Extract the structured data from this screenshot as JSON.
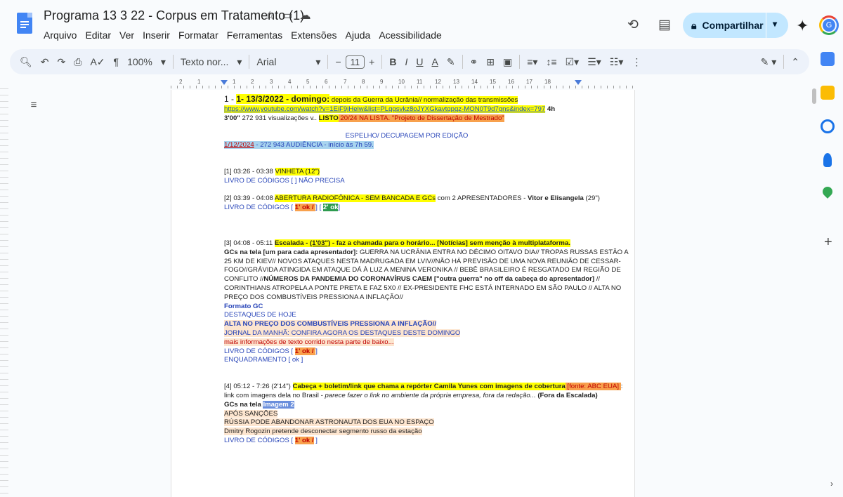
{
  "header": {
    "title": "Programa 13 3 22 - Corpus em Tratamento (1)",
    "menu": [
      "Arquivo",
      "Editar",
      "Ver",
      "Inserir",
      "Formatar",
      "Ferramentas",
      "Extensões",
      "Ajuda",
      "Acessibilidade"
    ],
    "share_label": "Compartilhar",
    "avatar_letter": "G"
  },
  "toolbar": {
    "zoom": "100%",
    "style": "Texto nor...",
    "font": "Arial",
    "font_size": "11"
  },
  "ruler": {
    "numbers": [
      "2",
      "1",
      "1",
      "1",
      "2",
      "3",
      "4",
      "5",
      "6",
      "7",
      "8",
      "9",
      "10",
      "11",
      "12",
      "13",
      "14",
      "15",
      "16",
      "17",
      "18"
    ]
  },
  "doc": {
    "l1_num": "1 -",
    "l1_hl": "1- 13/3/2022 - domingo:",
    "l1_rest": " depois da Guerra da Ucrânia// normalização das transmissões",
    "l2_link": "https://www.youtube.com/watch?v=1EiF9jHelw&list=PLqqsvkz8oJYXGkavtqpqz-MON0T9d7gns&index=797",
    "l2_dur": " 4h",
    "l3_a": "3'00\"",
    "l3_b": " 272 931 visualizações v.. ",
    "l3_listo": "LISTO",
    "l3_c": "  20/24 NA LISTA. \"Projeto de Dissertação de Mestrado\"",
    "espelho": "ESPELHO/ DECUPAGEM POR EDIÇÃO",
    "aud_date": "1/12/2024",
    "aud_rest": " - 272 943 AUDIÊNCIA  - início às 7h 59.",
    "s1_time": "[1] 03:26 - 03:38  ",
    "s1_hl": "VINHETA (12\")",
    "s1_livro": "LIVRO DE CÓDIGOS [  ] NÃO PRECISA",
    "s2_time": "[2] 03:39 - 04:08 ",
    "s2_hl": "ABERTURA RADIOFÔNICA - SEM BANCADA  E GCs",
    "s2_rest": " com 2 APRESENTADORES - ",
    "s2_names": "Vitor e Elisangela",
    "s2_dur": "  (29\")",
    "s2_livro": "LIVRO DE CÓDIGOS [ ",
    "s2_ok1": "1' ok  / ",
    "s2_mid": " ] [ ",
    "s2_ok2": "2' ok",
    "s2_end": "]",
    "s3_time": "[3] 04:08 - 05:11  ",
    "s3_hl_a": "Escalada - ",
    "s3_hl_b": "(1'03\")",
    "s3_hl_c": " - faz a chamada para o horário... [Notícias] sem menção à multiplataforma.",
    "s3_gcs_label": "GCs na tela [um para cada apresentador]:",
    "s3_gcs_text": "  GUERRA NA UCRÂNIA ENTRA NO DÉCIMO OITAVO DIA// TROPAS RUSSAS ESTÃO A 25 KM DE KIEV// NOVOS ATAQUES NESTA MADRUGADA EM LVIV//NÃO HÁ PREVISÃO DE UMA NOVA REUNIÃO DE CESSAR-FOGO//GRÁVIDA ATINGIDA EM ATAQUE DÁ À LUZ A MENINA VERONIKA // BEBÊ BRASILEIRO É RESGATADO EM REGIÃO DE CONFLITO //",
    "s3_gcs_bold": "NÚMEROS DA PANDEMIA DO CORONAVÍRUS CAEM [\"outra guerra\" no off da cabeça do apresentador]",
    "s3_gcs_text2": " // CORINTHIANS ATROPELA A PONTE PRETA E FAZ 5X0 // EX-PRESIDENTE FHC ESTÁ INTERNADO EM SÃO PAULO // ALTA NO PREÇO DOS COMBUSTÍVEIS PRESSIONA A INFLAÇÃO//",
    "s3_formato": "Formato GC",
    "s3_destaques": "DESTAQUES DE HOJE",
    "s3_alta": "ALTA NO PREÇO DOS COMBUSTÍVEIS PRESSIONA A INFLAÇÃO//",
    "s3_jornal": "JORNAL DA MANHÃ: CONFIRA AGORA OS DESTAQUES DESTE DOMINGO",
    "s3_mais": "mais informações de texto corrido nesta parte de baixo...",
    "s3_livro": "LIVRO DE CÓDIGOS [ ",
    "s3_ok": "1' ok  / ",
    "s3_livro_end": " ]",
    "s3_enq": "ENQUADRAMENTO [ ok  ]",
    "s4_time": "[4] 05:12 - 7:26  (2'14\")  ",
    "s4_hl": "Cabeça  + boletim/link que chama a repórter Camila Yunes com imagens de cobertura",
    "s4_fonte": " [fonte: ABC EUA] ",
    "s4_rest": ": link com imagens dela no Brasil - ",
    "s4_em": "parece fazer o link no ambiente da própria empresa, fora da redação...",
    "s4_fora": " (Fora da Escalada)",
    "s4_gcs": "GCs na tela ",
    "s4_img": "  Imagem 2 ",
    "s4_apos": "APÓS SANÇÕES",
    "s4_russia": "RÚSSIA PODE ABANDONAR ASTRONAUTA DOS EUA NO ESPAÇO",
    "s4_dmitry": "Dmitry Rogozin pretende desconectar segmento russo da estação",
    "s4_livro": "LIVRO DE CÓDIGOS [  ",
    "s4_ok": "1' ok  /",
    "s4_livro_end": " ]"
  }
}
